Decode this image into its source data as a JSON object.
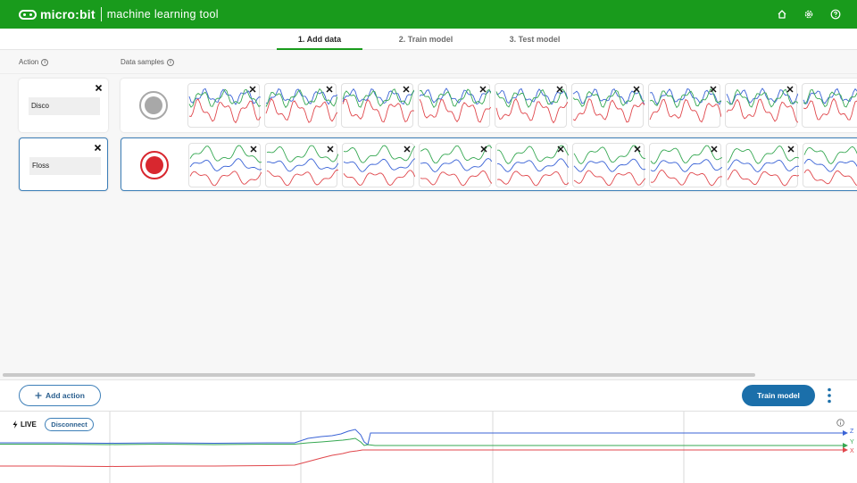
{
  "header": {
    "brand": "micro:bit",
    "product": "machine learning tool",
    "icons": [
      "home-icon",
      "settings-icon",
      "help-icon"
    ]
  },
  "tabs": [
    {
      "label": "1. Add data",
      "active": true
    },
    {
      "label": "2. Train model",
      "active": false
    },
    {
      "label": "3. Test model",
      "active": false
    }
  ],
  "columns": {
    "action": "Action",
    "samples": "Data samples"
  },
  "actions": [
    {
      "name": "Disco",
      "selected": false,
      "recording_color": "#a8a8a8",
      "sample_count": 9
    },
    {
      "name": "Floss",
      "selected": true,
      "recording_color": "#d8272f",
      "sample_count": 9
    }
  ],
  "toolbar": {
    "add_action_label": "Add action",
    "train_label": "Train model"
  },
  "live": {
    "label": "LIVE",
    "disconnect_label": "Disconnect",
    "axes": [
      "Z",
      "Y",
      "X"
    ]
  },
  "colors": {
    "brand_green": "#199b1c",
    "accent_blue": "#1b6faa",
    "x_red": "#e0474c",
    "y_green": "#36a852",
    "z_blue": "#3a63d6"
  }
}
